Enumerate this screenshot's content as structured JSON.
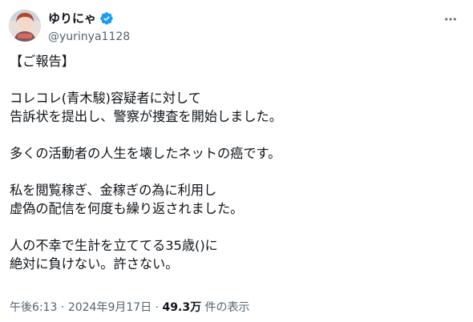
{
  "author": {
    "display_name": "ゆりにゃ",
    "handle": "@yurinya1128",
    "verified_color": "#1d9bf0"
  },
  "post": {
    "lines": [
      "【ご報告】",
      "",
      "コレコレ(青木駿)容疑者に対して",
      "告訴状を提出し、警察が捜査を開始しました。",
      "",
      "多くの活動者の人生を壊したネットの癌です。",
      "",
      "私を閲覧稼ぎ、金稼ぎの為に利用し",
      "虚偽の配信を何度も繰り返されました。",
      "",
      "人の不幸で生計を立ててる35歳()に",
      "絶対に負けない。許さない。"
    ]
  },
  "meta": {
    "time": "午後6:13",
    "sep1": "·",
    "date": "2024年9月17日",
    "sep2": "·",
    "views_count": "49.3万",
    "views_label": "件の表示"
  },
  "icons": {
    "more": "more-horizontal-icon",
    "verified": "verified-badge-icon"
  }
}
